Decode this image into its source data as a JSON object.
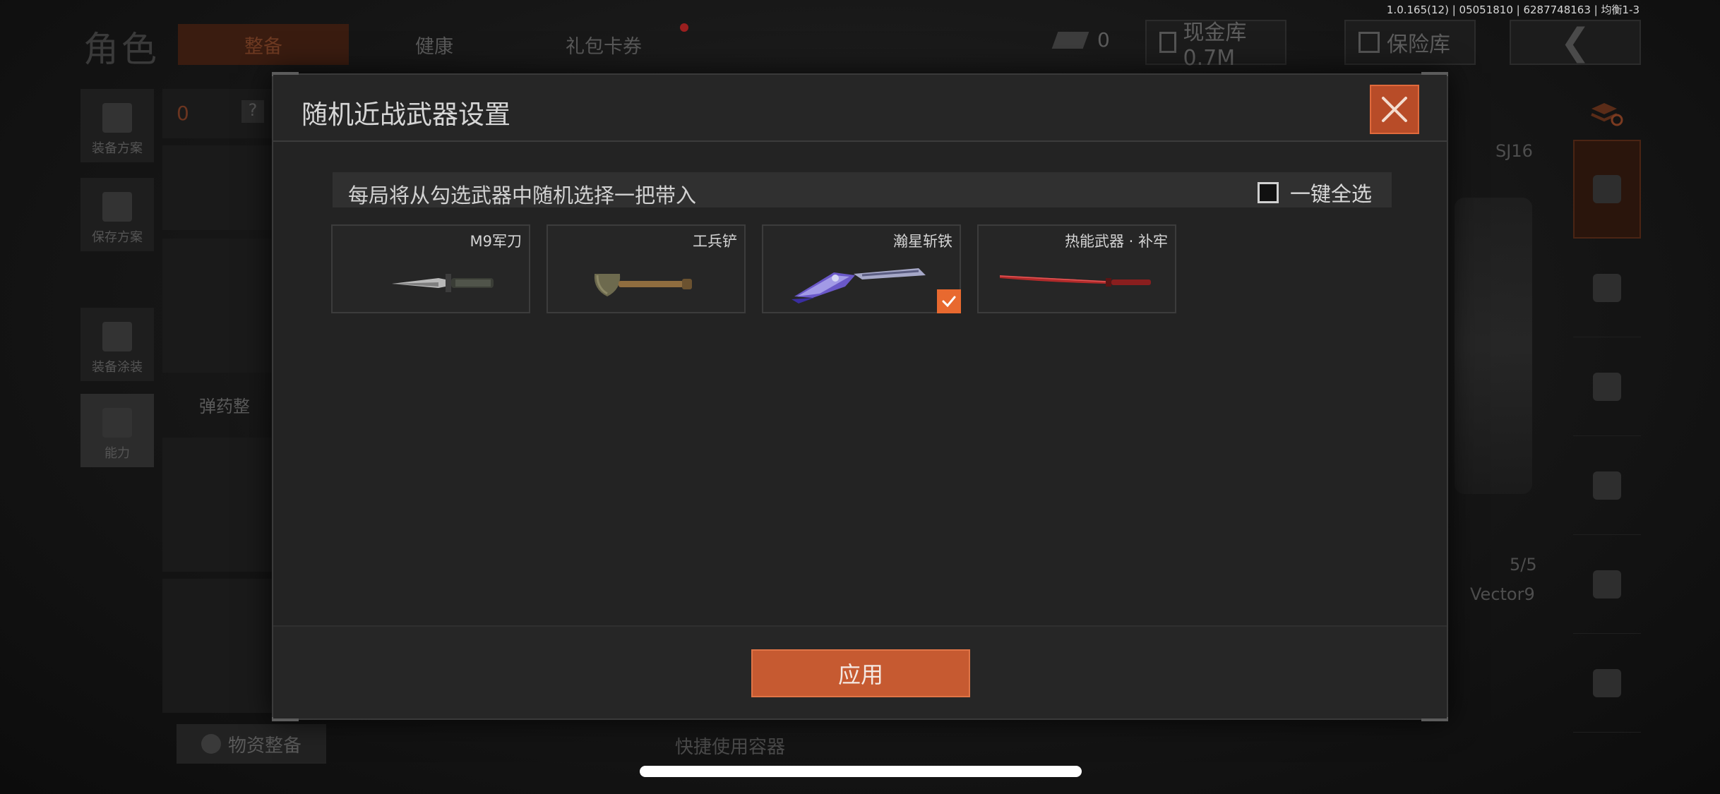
{
  "status": {
    "version": "1.0.165(12) | 05051810 | 6287748163 | 均衡1-3"
  },
  "background": {
    "page_title": "角色",
    "tabs": [
      {
        "label": "整备",
        "active": true
      },
      {
        "label": "健康",
        "active": false
      },
      {
        "label": "礼包卡券",
        "active": false
      }
    ],
    "currency_value": "0",
    "cash_vault_label": "现金库 0.7M",
    "safe_label": "保险库",
    "back_icon": "chevron-left-icon",
    "left_menu": [
      {
        "label": "装备方案",
        "icon": "vest-icon"
      },
      {
        "label": "保存方案",
        "icon": "download-icon"
      },
      {
        "label": "装备涂装",
        "icon": "helmet-icon"
      },
      {
        "label": "能力",
        "icon": "lightning-icon"
      }
    ],
    "inventory_count": "0",
    "help_symbol": "?",
    "ammo_label": "弹药整",
    "supplies_label": "物资整备",
    "quick_container_label": "快捷使用容器",
    "weapon_slot_1": "SJ16",
    "weapon_slot_1_count": "5/5",
    "weapon_slot_2": "Vector9"
  },
  "modal": {
    "title": "随机近战武器设置",
    "instruction": "每局将从勾选武器中随机选择一把带入",
    "select_all_label": "一键全选",
    "select_all_checked": false,
    "weapons": [
      {
        "name": "M9军刀",
        "checked": false,
        "icon": "combat-knife-icon"
      },
      {
        "name": "工兵铲",
        "checked": false,
        "icon": "shovel-icon"
      },
      {
        "name": "瀚星斩铁",
        "checked": true,
        "icon": "purple-blade-icon"
      },
      {
        "name": "热能武器 · 补牢",
        "checked": false,
        "icon": "red-katana-icon"
      }
    ],
    "apply_label": "应用",
    "accent_color": "#e8692f"
  }
}
